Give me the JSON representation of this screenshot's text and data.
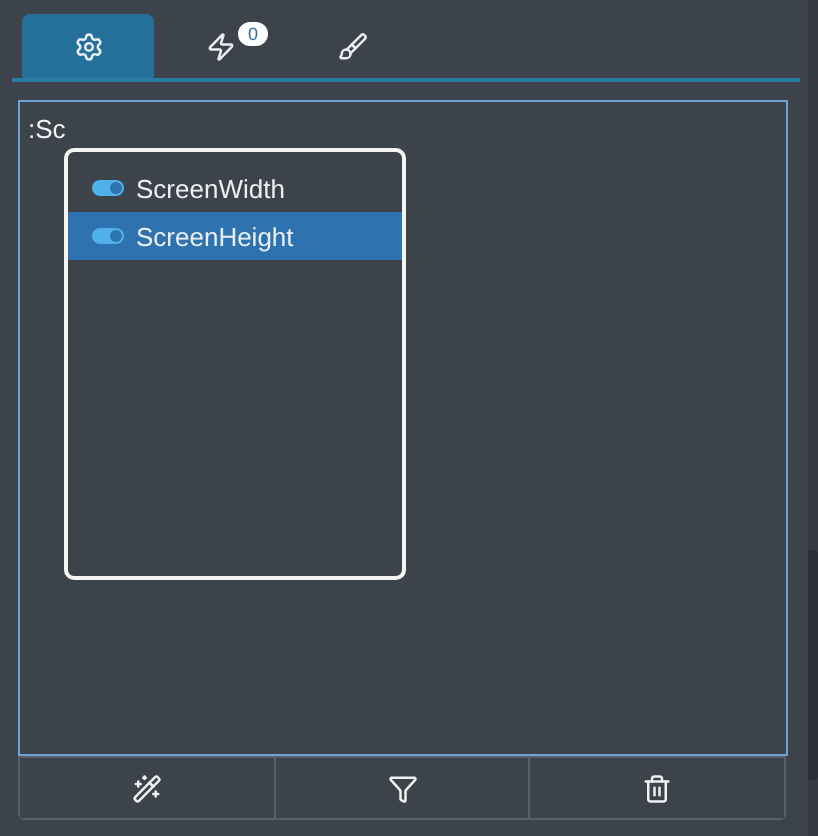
{
  "tabs": [
    {
      "kind": "settings",
      "selected": true
    },
    {
      "kind": "events",
      "selected": false,
      "badge": "0"
    },
    {
      "kind": "style",
      "selected": false
    }
  ],
  "editor": {
    "value": ":Sc"
  },
  "suggestions": [
    {
      "label": "ScreenWidth",
      "selected": false
    },
    {
      "label": "ScreenHeight",
      "selected": true
    }
  ],
  "toolbar": [
    {
      "kind": "magic"
    },
    {
      "kind": "filter"
    },
    {
      "kind": "delete"
    }
  ]
}
